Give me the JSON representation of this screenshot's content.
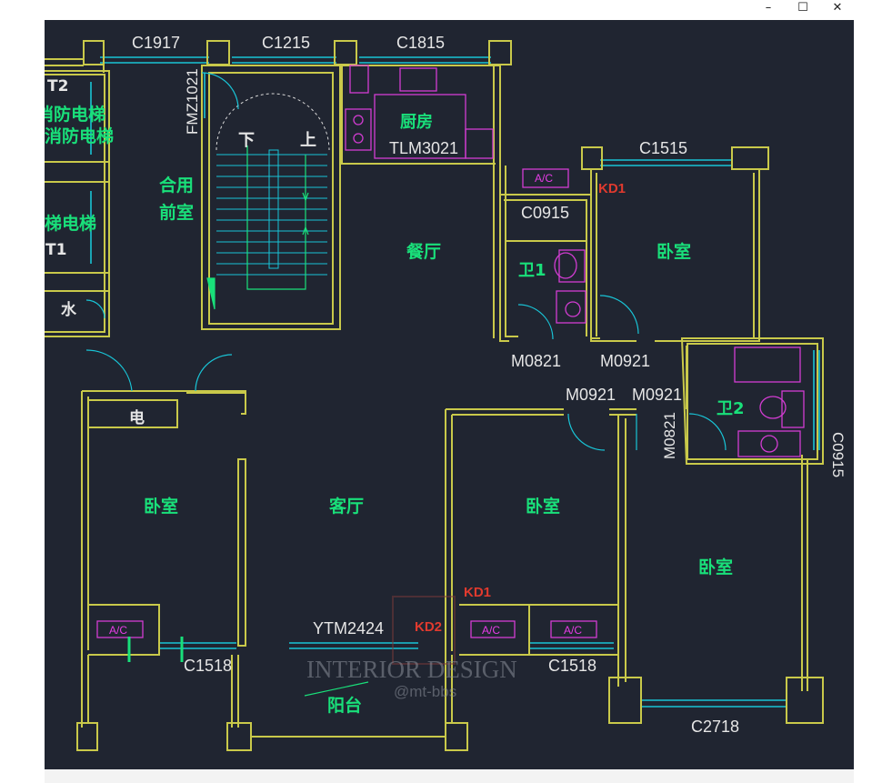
{
  "window": {
    "controls": {
      "minimize": "–",
      "maximize": "☐",
      "close": "✕"
    }
  },
  "rooms": {
    "elevator_t2": "T2",
    "elevator_top_1": "消防电梯",
    "elevator_top_2": "兼消防电梯",
    "elevator_mid": "客梯电梯",
    "elevator_t1": "T1",
    "water": "水",
    "shared_lobby_1": "合用",
    "shared_lobby_2": "前室",
    "stair_down": "下",
    "stair_up": "上",
    "kitchen": "厨房",
    "dining": "餐厅",
    "bath1": "卫1",
    "bedroom_ne": "卧室",
    "bath2": "卫2",
    "electric": "电",
    "bedroom_w": "卧室",
    "living": "客厅",
    "bedroom_c": "卧室",
    "bedroom_e": "卧室",
    "balcony": "阳台"
  },
  "labels": {
    "win_c1917": "C1917",
    "win_c1215": "C1215",
    "win_c1815": "C1815",
    "door_fmz": "FMZ1021",
    "door_tlm": "TLM3021",
    "win_c1515": "C1515",
    "win_c0915_a": "C0915",
    "door_m0821_a": "M0821",
    "door_m0921_a": "M0921",
    "door_m0921_b": "M0921",
    "door_m0921_c": "M0921",
    "door_m0821_b": "M0821",
    "win_c0915_b": "C0915",
    "door_ytm": "YTM2424",
    "win_c1518_a": "C1518",
    "win_c1518_b": "C1518",
    "win_c2718": "C2718",
    "kd1_a": "KD1",
    "kd1_b": "KD1",
    "kd2": "KD2",
    "ac1": "A/C",
    "ac2": "A/C",
    "ac3": "A/C",
    "ac4": "A/C"
  },
  "watermark": {
    "line1": "INTERIOR DESIGN",
    "line2": "@mt-bbs"
  },
  "colors": {
    "background": "#202531",
    "wall": "#c9c94a",
    "window": "#19c4d6",
    "room_text": "#19e07a",
    "annotation": "#e6e6e6",
    "fixture": "#d23cd2",
    "red_tag": "#e03a2e"
  }
}
